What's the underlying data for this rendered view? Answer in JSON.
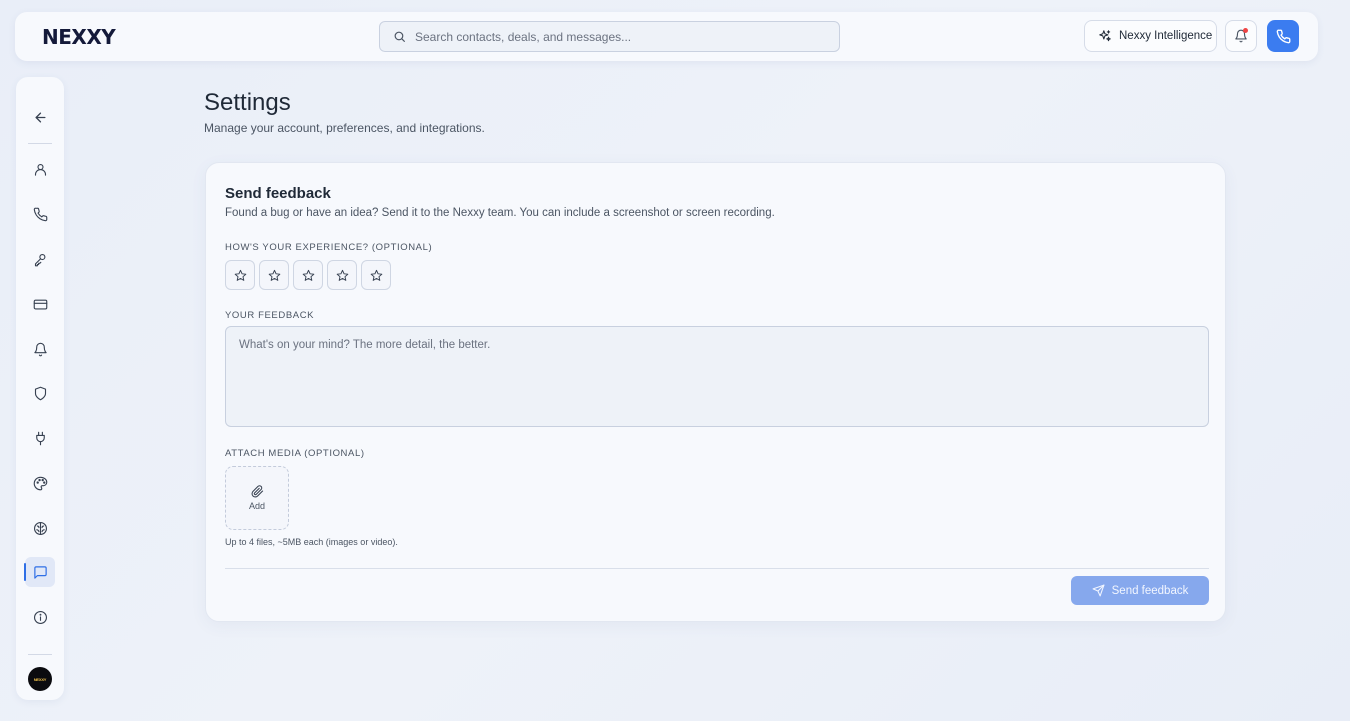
{
  "brand": {
    "logo_text": "NEXXY"
  },
  "search": {
    "placeholder": "Search contacts, deals, and messages..."
  },
  "header": {
    "intelligence_label": "Nexxy Intelligence",
    "has_notification": true,
    "accent_color": "#3b7cf0",
    "notification_color": "#ef4444"
  },
  "sidebar": {
    "items": [
      {
        "icon": "arrow-left-icon"
      },
      {
        "icon": "user-icon"
      },
      {
        "icon": "phone-icon"
      },
      {
        "icon": "key-icon"
      },
      {
        "icon": "credit-card-icon"
      },
      {
        "icon": "bell-icon"
      },
      {
        "icon": "shield-icon"
      },
      {
        "icon": "plug-icon"
      },
      {
        "icon": "palette-icon"
      },
      {
        "icon": "brain-icon"
      },
      {
        "icon": "message-square-icon",
        "active": true
      },
      {
        "icon": "info-icon"
      }
    ],
    "avatar_text": "NEXXY"
  },
  "page": {
    "title": "Settings",
    "subtitle": "Manage your account, preferences, and integrations."
  },
  "feedback": {
    "title": "Send feedback",
    "description": "Found a bug or have an idea? Send it to the Nexxy team. You can include a screenshot or screen recording.",
    "rating_label": "HOW'S YOUR EXPERIENCE? (OPTIONAL)",
    "rating_value": 0,
    "rating_max": 5,
    "feedback_label": "YOUR FEEDBACK",
    "feedback_placeholder": "What's on your mind? The more detail, the better.",
    "feedback_value": "",
    "attach_label": "ATTACH MEDIA (OPTIONAL)",
    "attach_button_label": "Add",
    "attach_hint": "Up to 4 files, ~5MB each (images or video).",
    "send_label": "Send feedback",
    "send_disabled": true
  }
}
